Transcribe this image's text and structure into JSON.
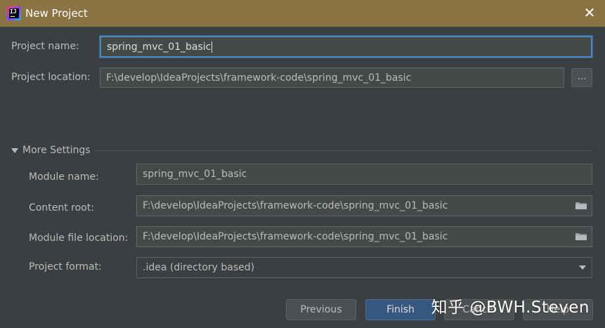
{
  "window": {
    "title": "New Project",
    "close_icon": "close-icon",
    "app_icon": "intellij-idea-icon"
  },
  "project": {
    "name_label": "Project name:",
    "name_value": "spring_mvc_01_basic",
    "location_label": "Project location:",
    "location_value": "F:\\develop\\IdeaProjects\\framework-code\\spring_mvc_01_basic",
    "browse_label": "..."
  },
  "more_settings": {
    "title": "More Settings",
    "expanded": true,
    "module_name_label": "Module name:",
    "module_name_value": "spring_mvc_01_basic",
    "content_root_label": "Content root:",
    "content_root_value": "F:\\develop\\IdeaProjects\\framework-code\\spring_mvc_01_basic",
    "module_file_label": "Module file location:",
    "module_file_value": "F:\\develop\\IdeaProjects\\framework-code\\spring_mvc_01_basic",
    "format_label": "Project format:",
    "format_value": ".idea (directory based)"
  },
  "footer": {
    "previous_label": "Previous",
    "finish_label": "Finish",
    "cancel_label": "Cancel",
    "help_label": "Help"
  },
  "watermark": "知乎 @BWH.Steven",
  "colors": {
    "background": "#3c3f41",
    "titlebar": "#8a7443",
    "focus_border": "#4a88c7",
    "primary_button": "#365880"
  }
}
